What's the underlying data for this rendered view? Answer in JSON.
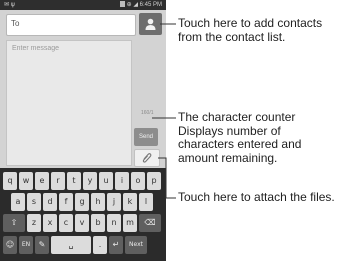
{
  "statusbar": {
    "left_icons": "✉ ψ",
    "right_text": "⊕ ◢ 6:45 PM"
  },
  "compose": {
    "to_label": "To",
    "message_placeholder": "Enter message",
    "counter_text": "160/1",
    "send_label": "Send"
  },
  "keyboard": {
    "row1": [
      "q",
      "w",
      "e",
      "r",
      "t",
      "y",
      "u",
      "i",
      "o",
      "p"
    ],
    "row2": [
      "a",
      "s",
      "d",
      "f",
      "g",
      "h",
      "j",
      "k",
      "l"
    ],
    "row3": [
      "⇧",
      "z",
      "x",
      "c",
      "v",
      "b",
      "n",
      "m",
      "⌫"
    ],
    "row4": [
      "☺",
      "EN",
      "✎",
      "␣",
      ".",
      "↵",
      "Next"
    ]
  },
  "callouts": {
    "contacts": "Touch here to add contacts from the contact list.",
    "counter": "The character counter Displays number of characters entered and amount remaining.",
    "attach": "Touch here to attach the files."
  },
  "colors": {
    "screen_bg": "#d3d3d3",
    "keyboard_bg": "#2b2b2b",
    "key_bg": "#dcdcdc"
  }
}
